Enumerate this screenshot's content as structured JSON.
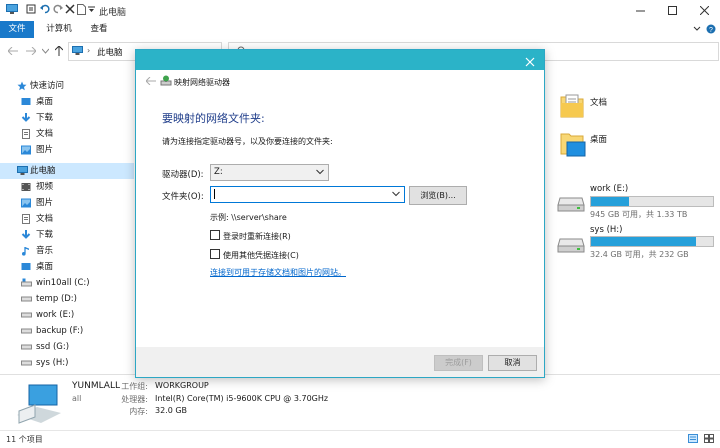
{
  "window": {
    "title": "此电脑"
  },
  "ribbon": {
    "tabs": [
      "文件",
      "计算机",
      "查看"
    ]
  },
  "address": {
    "path": "此电脑"
  },
  "sidebar": {
    "items": [
      {
        "label": "快速访问",
        "icon": "star-icon",
        "group": true
      },
      {
        "label": "桌面",
        "icon": "desktop-icon"
      },
      {
        "label": "下载",
        "icon": "download-icon"
      },
      {
        "label": "文档",
        "icon": "document-icon"
      },
      {
        "label": "图片",
        "icon": "picture-icon"
      },
      {
        "label": "此电脑",
        "icon": "computer-icon",
        "group": true,
        "selected": true
      },
      {
        "label": "视频",
        "icon": "video-icon"
      },
      {
        "label": "图片",
        "icon": "picture-icon"
      },
      {
        "label": "文档",
        "icon": "document-icon"
      },
      {
        "label": "下载",
        "icon": "download-icon"
      },
      {
        "label": "音乐",
        "icon": "music-icon"
      },
      {
        "label": "桌面",
        "icon": "desktop-icon"
      },
      {
        "label": "win10all (C:)",
        "icon": "drive-icon"
      },
      {
        "label": "temp (D:)",
        "icon": "drive-icon"
      },
      {
        "label": "work (E:)",
        "icon": "drive-icon"
      },
      {
        "label": "backup (F:)",
        "icon": "drive-icon"
      },
      {
        "label": "ssd (G:)",
        "icon": "drive-icon"
      },
      {
        "label": "sys (H:)",
        "icon": "drive-icon"
      }
    ]
  },
  "content": {
    "folders": [
      {
        "name": "文档"
      },
      {
        "name": "桌面"
      }
    ],
    "drives": [
      {
        "name": "work (E:)",
        "info": "945 GB 可用，共 1.33 TB",
        "used_fraction": 0.31
      },
      {
        "name": "sys (H:)",
        "info": "32.4 GB 可用，共 232 GB",
        "used_fraction": 0.86
      }
    ],
    "accent_color": "#26a0da"
  },
  "details": {
    "computer_name": "YUNMLALL",
    "sub": "all",
    "workgroup_label": "工作组:",
    "workgroup_value": "WORKGROUP",
    "cpu_label": "处理器:",
    "cpu_value": "Intel(R) Core(TM) i5-9600K CPU @ 3.70GHz",
    "mem_label": "内存:",
    "mem_value": "32.0 GB"
  },
  "status": {
    "count": "11 个项目"
  },
  "dialog": {
    "title": "映射网络驱动器",
    "heading": "要映射的网络文件夹:",
    "instruction": "请为连接指定驱动器号，以及你要连接的文件夹:",
    "drive_label": "驱动器(D):",
    "drive_value": "Z:",
    "folder_label": "文件夹(O):",
    "folder_value": "",
    "browse_label": "浏览(B)...",
    "example": "示例: \\\\server\\share",
    "reconnect_label": "登录时重新连接(R)",
    "other_creds_label": "使用其他凭据连接(C)",
    "link": "连接到可用于存储文档和图片的网站。",
    "finish_label": "完成(F)",
    "cancel_label": "取消",
    "header_color": "#2bb3c8"
  }
}
